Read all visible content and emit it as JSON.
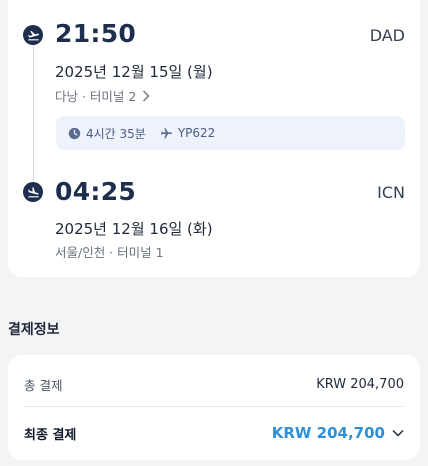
{
  "departure": {
    "time": "21:50",
    "code": "DAD",
    "date": "2025년 12월 15일 (월)",
    "terminal": "다낭 · 터미널 2"
  },
  "flight_info": {
    "duration": "4시간 35분",
    "flight_number": "YP622"
  },
  "arrival": {
    "time": "04:25",
    "code": "ICN",
    "date": "2025년 12월 16일 (화)",
    "terminal": "서울/인천 · 터미널 1"
  },
  "payment": {
    "section_title": "결제정보",
    "total_label": "총 결제",
    "total_value": "KRW 204,700",
    "final_label": "최종 결제",
    "final_value": "KRW 204,700"
  },
  "icons": {
    "departure": "plane-departure-icon",
    "arrival": "plane-arrival-icon",
    "duration": "clock-icon",
    "flight": "plane-icon",
    "terminal_link": "chevron-right-icon",
    "expand": "chevron-down-icon"
  },
  "colors": {
    "navy": "#1e2f4d",
    "accent_blue": "#2f8fd8",
    "pill_bg": "#eef2fa",
    "page_bg": "#f3f4f6"
  }
}
